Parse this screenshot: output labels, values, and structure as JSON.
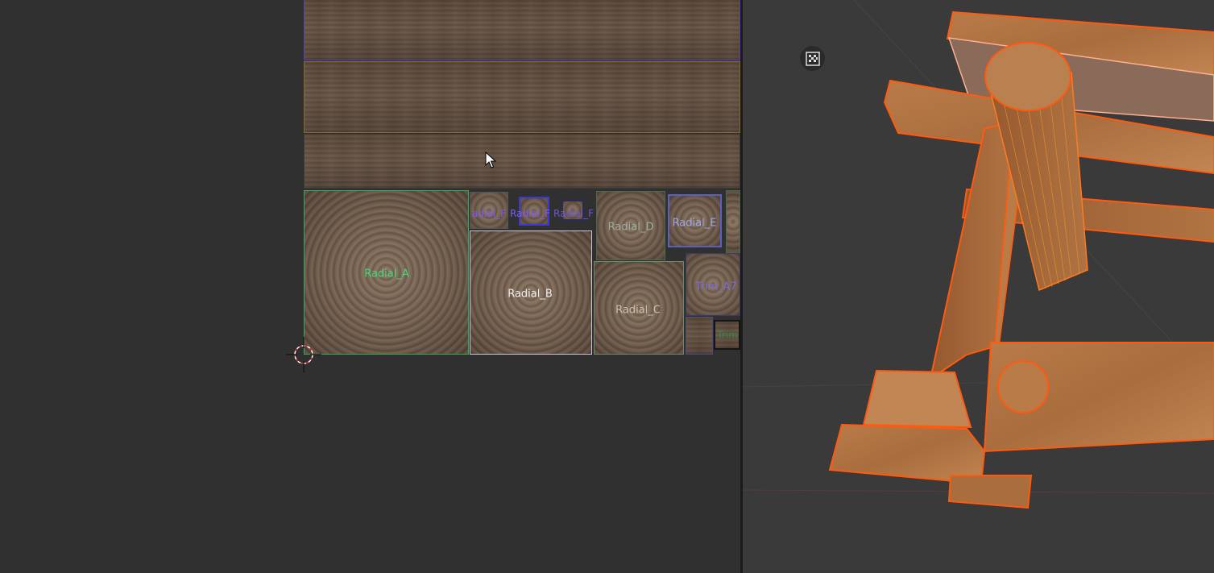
{
  "uv_editor": {
    "islands": {
      "radial_a": "Radial_A",
      "radial_b": "Radial_B",
      "radial_c": "Radial_C",
      "radial_d": "Radial_D",
      "radial_e": "Radial_E",
      "radial_f1": "adial_F",
      "radial_f2": "Radial_F",
      "radial_f3": "Radial_F",
      "trim_a7": "Trim_A7",
      "trim": "Trim"
    },
    "colors": {
      "radial_a_border": "#2fae5a",
      "selected_label": "#46d97a",
      "island_outline_purple": "#6a4fd0",
      "island_outline_orange": "#c08a2a"
    }
  },
  "toolbar": {
    "tools": [
      {
        "name": "select-box-icon"
      },
      {
        "name": "extrude-region-icon"
      },
      {
        "name": "inset-faces-icon"
      },
      {
        "name": "bevel-icon"
      },
      {
        "name": "loop-cut-icon"
      },
      {
        "name": "knife-icon"
      },
      {
        "name": "poly-build-icon"
      },
      {
        "name": "spin-icon"
      },
      {
        "name": "smooth-icon"
      },
      {
        "name": "edge-slide-icon"
      },
      {
        "name": "shrink-fatten-icon"
      },
      {
        "name": "add-cube-icon"
      },
      {
        "name": "addon-tool-icon"
      },
      {
        "name": "bend-icon"
      },
      {
        "name": "shear-icon"
      },
      {
        "name": "rotate-icon"
      },
      {
        "name": "cursor-tool-icon"
      }
    ]
  },
  "viewport": {
    "checker_toggle": "checker-icon",
    "selection_color": "#ff6a1a",
    "wood_color": "#b07040"
  }
}
